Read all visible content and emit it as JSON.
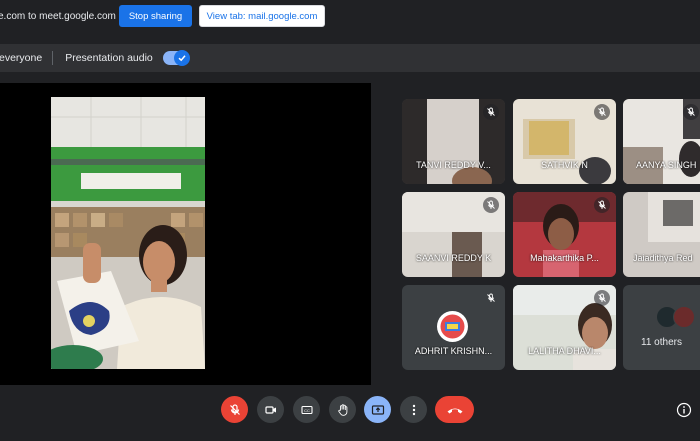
{
  "share_bar": {
    "text": "e.com to meet.google.com",
    "stop_label": "Stop sharing",
    "view_label": "View tab: mail.google.com"
  },
  "audio_bar": {
    "everyone_label": "everyone",
    "audio_label": "Presentation audio",
    "audio_on": true
  },
  "participants": [
    {
      "name": "TANVI REDDY V...",
      "mic": "off"
    },
    {
      "name": "SATHVIK N",
      "mic": "off"
    },
    {
      "name": "AANYA SINGH",
      "mic": "off"
    },
    {
      "name": "SAANVI REDDY K",
      "mic": "off"
    },
    {
      "name": "Mahakarthika P...",
      "mic": "off"
    },
    {
      "name": "Jaiadithya Red",
      "mic": "off"
    },
    {
      "name": "ADHRIT KRISHN...",
      "mic": "off"
    },
    {
      "name": "LALITHA DHAVI...",
      "mic": "off"
    }
  ],
  "others": {
    "label": "11 others"
  },
  "colors": {
    "background": "#202124",
    "primary_blue": "#1a73e8",
    "danger_red": "#ea4335",
    "present_blue": "#8ab4f8"
  },
  "controls": {
    "mic_state": "off",
    "icons": [
      "mic-off-icon",
      "camera-icon",
      "captions-icon",
      "raise-hand-icon",
      "present-icon",
      "more-options-icon",
      "end-call-icon",
      "info-icon"
    ]
  }
}
